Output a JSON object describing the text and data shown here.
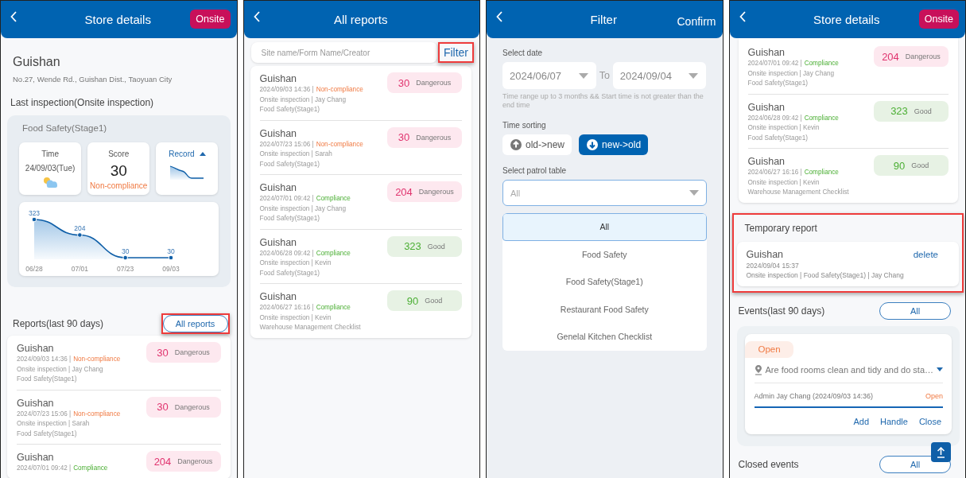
{
  "panels": [
    {
      "kind": "store",
      "header": {
        "title": "Store details",
        "action": {
          "kind": "button",
          "label": "Onsite"
        }
      },
      "store": {
        "name": "Guishan",
        "address": "No.27, Wende Rd., Guishan Dist., Taoyuan City"
      },
      "last_inspection": {
        "heading": "Last inspection(Onsite inspection)",
        "form": "Food Safety(Stage1)",
        "time_label": "Time",
        "time": "24/09/03(Tue)",
        "score_label": "Score",
        "score": "30",
        "result": "Non-compliance",
        "record_label": "Record",
        "chart_data": {
          "type": "area",
          "categories": [
            "06/28",
            "07/01",
            "07/23",
            "09/03"
          ],
          "values": [
            323,
            204,
            30,
            30
          ],
          "data_labels": true
        }
      },
      "reports": {
        "heading": "Reports(last 90 days)",
        "button": {
          "label": "All reports",
          "highlighted": true
        },
        "items": [
          {
            "site": "Guishan",
            "date": "2024/09/03  14:36 |",
            "status": "Non-compliance",
            "compliant": false,
            "detail": "Onsite inspection | Jay Chang",
            "form": "Food Safety(Stage1)",
            "score": "30",
            "rating": "Dangerous",
            "kind": "danger"
          },
          {
            "site": "Guishan",
            "date": "2024/07/23  15:06 |",
            "status": "Non-compliance",
            "compliant": false,
            "detail": "Onsite inspection | Sarah",
            "form": "Food Safety(Stage1)",
            "score": "30",
            "rating": "Dangerous",
            "kind": "danger"
          },
          {
            "site": "Guishan",
            "date": "2024/07/01  09:42 |",
            "status": "Compliance",
            "compliant": true,
            "score": "204",
            "rating": "Dangerous",
            "kind": "danger"
          }
        ]
      }
    },
    {
      "kind": "reports",
      "header": {
        "title": "All reports"
      },
      "search": {
        "placeholder": "Site name/Form Name/Creator"
      },
      "filter": {
        "label": "Filter",
        "highlighted": true
      },
      "items": [
        {
          "site": "Guishan",
          "date": "2024/09/03  14:36 |",
          "status": "Non-compliance",
          "compliant": false,
          "detail": "Onsite inspection | Jay Chang",
          "form": "Food Safety(Stage1)",
          "score": "30",
          "rating": "Dangerous",
          "kind": "danger"
        },
        {
          "site": "Guishan",
          "date": "2024/07/23  15:06 |",
          "status": "Non-compliance",
          "compliant": false,
          "detail": "Onsite inspection | Sarah",
          "form": "Food Safety(Stage1)",
          "score": "30",
          "rating": "Dangerous",
          "kind": "danger"
        },
        {
          "site": "Guishan",
          "date": "2024/07/01  09:42 |",
          "status": "Compliance",
          "compliant": true,
          "detail": "Onsite inspection | Jay Chang",
          "form": "Food Safety(Stage1)",
          "score": "204",
          "rating": "Dangerous",
          "kind": "danger"
        },
        {
          "site": "Guishan",
          "date": "2024/06/28  09:42 |",
          "status": "Compliance",
          "compliant": true,
          "detail": "Onsite inspection | Kevin",
          "form": "Food Safety(Stage1)",
          "score": "323",
          "rating": "Good",
          "kind": "good"
        },
        {
          "site": "Guishan",
          "date": "2024/06/27  16:16 |",
          "status": "Compliance",
          "compliant": true,
          "detail": "Onsite inspection | Kevin",
          "form": "Warehouse Management Checklist",
          "score": "90",
          "rating": "Good",
          "kind": "good"
        }
      ]
    },
    {
      "kind": "filter",
      "header": {
        "title": "Filter",
        "action": {
          "kind": "text",
          "label": "Confirm"
        }
      },
      "date_label": "Select date",
      "date_from": "2024/06/07",
      "date_separator": "To",
      "date_to": "2024/09/04",
      "hint": "Time range up to 3 months && Start time is not greater than the end time",
      "sorting_label": "Time sorting",
      "sorting": [
        {
          "label": "old->new",
          "selected": false
        },
        {
          "label": "new->old",
          "selected": true
        }
      ],
      "table_label": "Select patrol table",
      "table_value": "All",
      "options": [
        {
          "label": "All",
          "selected": true
        },
        {
          "label": "Food Safety",
          "selected": false
        },
        {
          "label": "Food Safety(Stage1)",
          "selected": false
        },
        {
          "label": "Restaurant Food Safety",
          "selected": false
        },
        {
          "label": "Genelal Kitchen Checklist",
          "selected": false
        }
      ]
    },
    {
      "kind": "store_scrolled",
      "header": {
        "title": "Store details",
        "action": {
          "kind": "button",
          "label": "Onsite"
        }
      },
      "items": [
        {
          "site": "Guishan",
          "date": "2024/07/01  09:42 |",
          "status": "Compliance",
          "compliant": true,
          "detail": "Onsite inspection | Jay Chang",
          "form": "Food Safety(Stage1)",
          "score": "204",
          "rating": "Dangerous",
          "kind": "danger"
        },
        {
          "site": "Guishan",
          "date": "2024/06/28  09:42 |",
          "status": "Compliance",
          "compliant": true,
          "detail": "Onsite inspection | Kevin",
          "form": "Food Safety(Stage1)",
          "score": "323",
          "rating": "Good",
          "kind": "good"
        },
        {
          "site": "Guishan",
          "date": "2024/06/27  16:16 |",
          "status": "Compliance",
          "compliant": true,
          "detail": "Onsite inspection | Kevin",
          "form": "Warehouse Management Checklist",
          "score": "90",
          "rating": "Good",
          "kind": "good"
        }
      ],
      "temporary_report": {
        "heading": "Temporary report",
        "highlighted": true,
        "site": "Guishan",
        "action": "delete",
        "date": "2024/09/04 15:37",
        "detail": "Onsite inspection | Food Safety(Stage1) | Jay Chang"
      },
      "events": {
        "heading": "Events(last 90 days)",
        "button": "All",
        "items": [
          {
            "status": "Open",
            "question": "Are food rooms clean and tidy and do sta…",
            "author": "Admin Jay Chang (2024/09/03 14:36)",
            "reply_status": "Open",
            "actions": [
              "Add",
              "Handle",
              "Close"
            ]
          }
        ]
      },
      "closed_events": {
        "heading": "Closed events",
        "button": "All"
      }
    }
  ]
}
